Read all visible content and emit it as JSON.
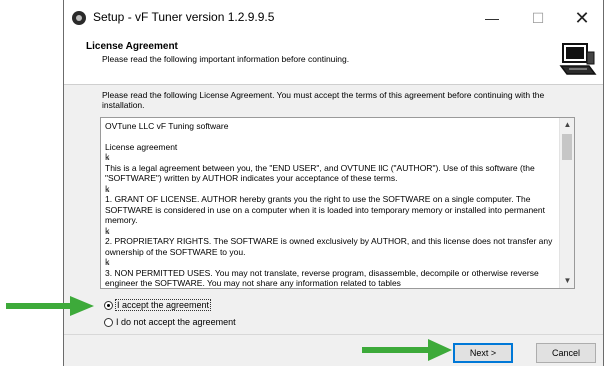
{
  "window": {
    "title": "Setup - vF Tuner version 1.2.9.9.5",
    "controls": {
      "minimize": "—",
      "maximize": "☐",
      "close": "✕"
    }
  },
  "header": {
    "title": "License Agreement",
    "subtitle": "Please read the following important information before continuing.",
    "icon": "installer-computer-icon"
  },
  "instructions": "Please read the following License Agreement. You must accept the terms of this agreement before continuing with the installation.",
  "license": {
    "lines": [
      "OVTune LLC vF Tuning software",
      "",
      "License agreement",
      "ꝃ",
      "This is a legal agreement between you, the \"END USER\", and OVTUNE llC (\"AUTHOR\"). Use of this software (the \"SOFTWARE\") written by AUTHOR indicates your acceptance of these terms.",
      "ꝃ",
      "1. GRANT OF LICENSE. AUTHOR hereby grants you the right to use the SOFTWARE on a single computer. The SOFTWARE is considered in use on a computer when it is loaded into temporary memory or installed into permanent memory.",
      "ꝃ",
      "2. PROPRIETARY RIGHTS. The SOFTWARE is owned exclusively by AUTHOR, and this license does not transfer any ownership of the SOFTWARE to you.",
      "ꝃ",
      "3. NON PERMITTED USES. You may not translate, reverse program, disassemble, decompile or otherwise reverse engineer the SOFTWARE. You may not share any information related to tables"
    ],
    "scroll_up": "▲",
    "scroll_down": "▼"
  },
  "radios": {
    "accept": {
      "label": "I accept the agreement",
      "checked": true
    },
    "decline": {
      "label": "I do not accept the agreement",
      "checked": false
    }
  },
  "buttons": {
    "next": "Next >",
    "cancel": "Cancel"
  },
  "colors": {
    "arrow": "#3daa3a",
    "focus": "#0078d7"
  }
}
